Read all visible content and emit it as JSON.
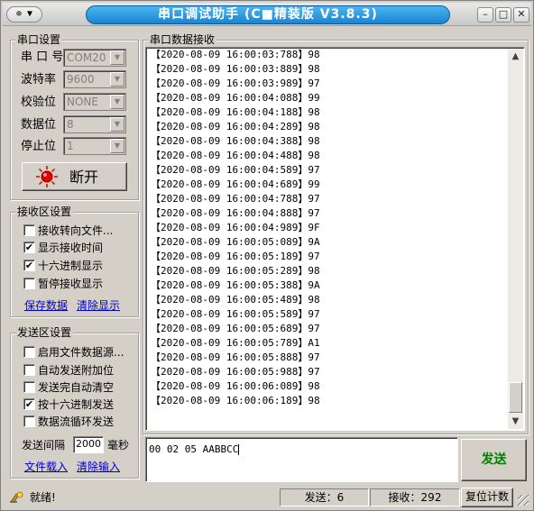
{
  "titlebar": {
    "sysmenu": "⊚ ▼",
    "title": "串口调试助手 (C■精装版 V3.8.3)",
    "minimize": "–",
    "maximize": "□",
    "close": "✕"
  },
  "serial": {
    "group_title": "串口设置",
    "port_label": "串 口 号",
    "port_value": "COM20",
    "baud_label": "波特率",
    "baud_value": "9600",
    "parity_label": "校验位",
    "parity_value": "NONE",
    "databits_label": "数据位",
    "databits_value": "8",
    "stopbits_label": "停止位",
    "stopbits_value": "1",
    "connect_button": "断开",
    "connect_indicator_color": "#e00000"
  },
  "receive_settings": {
    "group_title": "接收区设置",
    "options": [
      {
        "label": "接收转向文件...",
        "checked": false
      },
      {
        "label": "显示接收时间",
        "checked": true
      },
      {
        "label": "十六进制显示",
        "checked": true
      },
      {
        "label": "暂停接收显示",
        "checked": false
      }
    ],
    "save_link": "保存数据",
    "clear_link": "清除显示"
  },
  "send_settings": {
    "group_title": "发送区设置",
    "options": [
      {
        "label": "启用文件数据源...",
        "checked": false
      },
      {
        "label": "自动发送附加位",
        "checked": false
      },
      {
        "label": "发送完自动清空",
        "checked": false
      },
      {
        "label": "按十六进制发送",
        "checked": true
      },
      {
        "label": "数据流循环发送",
        "checked": false
      }
    ],
    "interval_label": "发送间隔",
    "interval_value": "2000",
    "interval_unit": "毫秒",
    "load_file_link": "文件载入",
    "clear_input_link": "清除输入"
  },
  "receive_area": {
    "group_title": "串口数据接收",
    "lines": [
      "【2020-08-09 16:00:03:788】98",
      "【2020-08-09 16:00:03:889】98",
      "【2020-08-09 16:00:03:989】97",
      "【2020-08-09 16:00:04:088】99",
      "【2020-08-09 16:00:04:188】98",
      "【2020-08-09 16:00:04:289】98",
      "【2020-08-09 16:00:04:388】98",
      "【2020-08-09 16:00:04:488】98",
      "【2020-08-09 16:00:04:589】97",
      "【2020-08-09 16:00:04:689】99",
      "【2020-08-09 16:00:04:788】97",
      "【2020-08-09 16:00:04:888】97",
      "【2020-08-09 16:00:04:989】9F",
      "【2020-08-09 16:00:05:089】9A",
      "【2020-08-09 16:00:05:189】97",
      "【2020-08-09 16:00:05:289】98",
      "【2020-08-09 16:00:05:388】9A",
      "【2020-08-09 16:00:05:489】98",
      "【2020-08-09 16:00:05:589】97",
      "【2020-08-09 16:00:05:689】97",
      "【2020-08-09 16:00:05:789】A1",
      "【2020-08-09 16:00:05:888】97",
      "【2020-08-09 16:00:05:988】97",
      "【2020-08-09 16:00:06:089】98",
      "【2020-08-09 16:00:06:189】98"
    ]
  },
  "send_area": {
    "input_value": "00 02 05 AABBCC",
    "send_button": "发送",
    "send_button_color": "#008000"
  },
  "statusbar": {
    "status_text": "就绪!",
    "sent_text": "发送：6",
    "received_text": "接收：292",
    "reset_button": "复位计数"
  }
}
